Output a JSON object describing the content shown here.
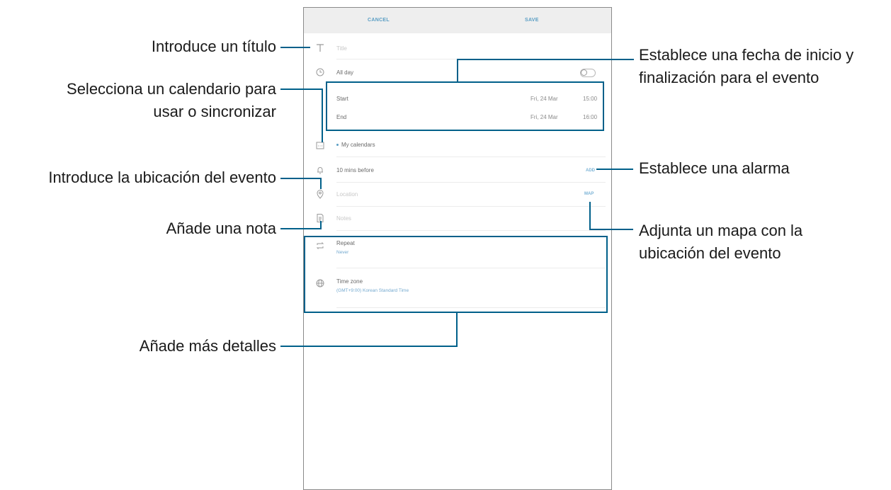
{
  "screen": {
    "header": {
      "cancel_label": "CANCEL",
      "save_label": "SAVE"
    },
    "title_row": {
      "placeholder": "Title"
    },
    "all_day_row": {
      "label": "All day",
      "toggle_on": false
    },
    "start_row": {
      "label": "Start",
      "date": "Fri, 24 Mar",
      "time": "15:00"
    },
    "end_row": {
      "label": "End",
      "date": "Fri, 24 Mar",
      "time": "16:00"
    },
    "calendar_row": {
      "label": "My calendars"
    },
    "alarm_row": {
      "label": "10 mins before",
      "action": "ADD"
    },
    "location_row": {
      "placeholder": "Location",
      "action": "MAP"
    },
    "notes_row": {
      "placeholder": "Notes"
    },
    "repeat_row": {
      "label": "Repeat",
      "value": "Never"
    },
    "timezone_row": {
      "label": "Time zone",
      "value": "(GMT+9:00) Korean Standard Time"
    }
  },
  "annotations": {
    "title": "Introduce un título",
    "calendar_line1": "Selecciona un calendario para",
    "calendar_line2": "usar o sincronizar",
    "location": "Introduce la ubicación del evento",
    "note": "Añade una nota",
    "details": "Añade más detalles",
    "dates_line1": "Establece una fecha de inicio y",
    "dates_line2": "finalización para el evento",
    "alarm": "Establece una alarma",
    "map_line1": "Adjunta un mapa con la",
    "map_line2": "ubicación del evento"
  },
  "colors": {
    "callout": "#00608a",
    "accent": "#5a9ec4"
  }
}
